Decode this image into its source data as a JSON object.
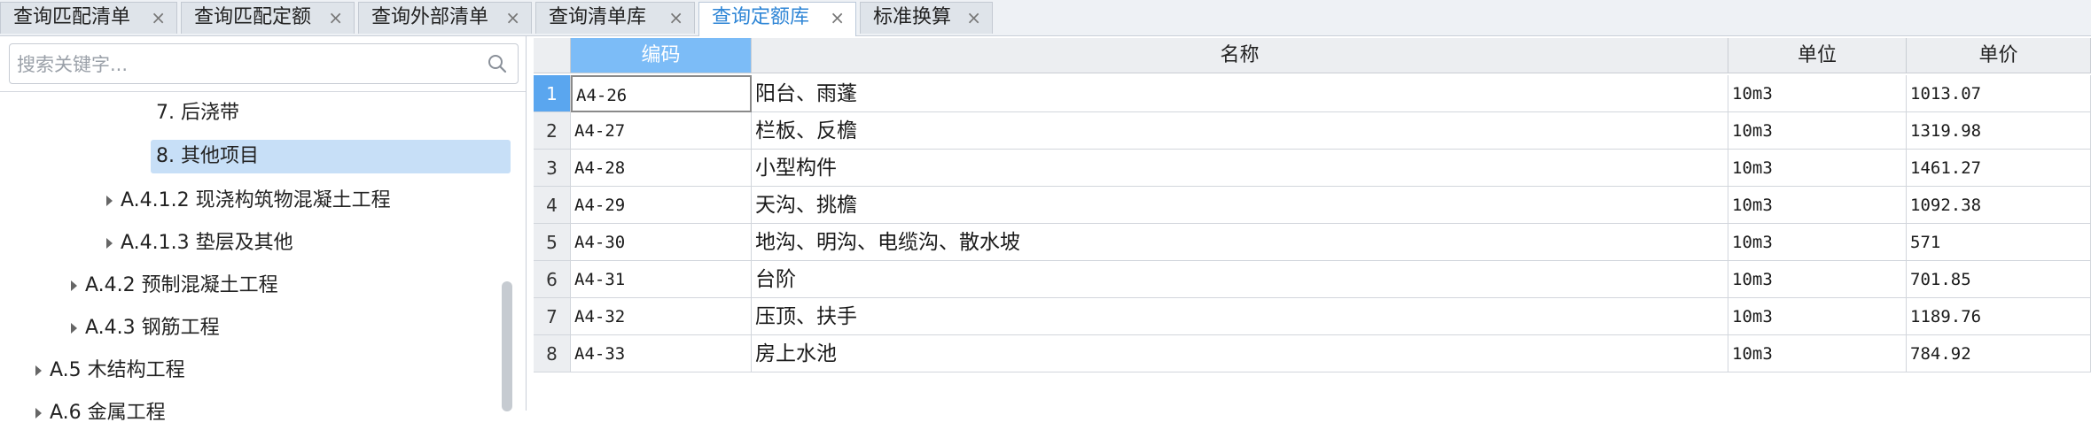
{
  "tabs": [
    {
      "label": "查询匹配清单",
      "active": false
    },
    {
      "label": "查询匹配定额",
      "active": false
    },
    {
      "label": "查询外部清单",
      "active": false
    },
    {
      "label": "查询清单库",
      "active": false
    },
    {
      "label": "查询定额库",
      "active": true
    },
    {
      "label": "标准换算",
      "active": false
    }
  ],
  "close_glyph": "×",
  "search": {
    "placeholder": "搜索关键字...",
    "value": "",
    "icon": "search-icon"
  },
  "tree": {
    "nodes": [
      {
        "label": "7. 后浇带",
        "expandable": false,
        "selected": false
      },
      {
        "label": "8. 其他项目",
        "expandable": false,
        "selected": true
      },
      {
        "label": "A.4.1.2 现浇构筑物混凝土工程",
        "expandable": true,
        "selected": false
      },
      {
        "label": "A.4.1.3 垫层及其他",
        "expandable": true,
        "selected": false
      },
      {
        "label": "A.4.2 预制混凝土工程",
        "expandable": true,
        "selected": false
      },
      {
        "label": "A.4.3 钢筋工程",
        "expandable": true,
        "selected": false
      },
      {
        "label": "A.5 木结构工程",
        "expandable": true,
        "selected": false
      },
      {
        "label": "A.6 金属工程",
        "expandable": true,
        "selected": false
      }
    ]
  },
  "grid": {
    "columns": [
      "编码",
      "名称",
      "单位",
      "单价"
    ],
    "selected_column": "编码",
    "rows": [
      {
        "num": "1",
        "code": "A4-26",
        "name": "阳台、雨蓬",
        "unit": "10m3",
        "price": "1013.07"
      },
      {
        "num": "2",
        "code": "A4-27",
        "name": "栏板、反檐",
        "unit": "10m3",
        "price": "1319.98"
      },
      {
        "num": "3",
        "code": "A4-28",
        "name": "小型构件",
        "unit": "10m3",
        "price": "1461.27"
      },
      {
        "num": "4",
        "code": "A4-29",
        "name": "天沟、挑檐",
        "unit": "10m3",
        "price": "1092.38"
      },
      {
        "num": "5",
        "code": "A4-30",
        "name": "地沟、明沟、电缆沟、散水坡",
        "unit": "10m3",
        "price": "571"
      },
      {
        "num": "6",
        "code": "A4-31",
        "name": "台阶",
        "unit": "10m3",
        "price": "701.85"
      },
      {
        "num": "7",
        "code": "A4-32",
        "name": "压顶、扶手",
        "unit": "10m3",
        "price": "1189.76"
      },
      {
        "num": "8",
        "code": "A4-33",
        "name": "房上水池",
        "unit": "10m3",
        "price": "784.92"
      }
    ],
    "active_row": "1"
  },
  "colors": {
    "accent": "#2f86d6",
    "header_selected": "#7cbcf7",
    "tree_selected": "#c7dff7"
  }
}
